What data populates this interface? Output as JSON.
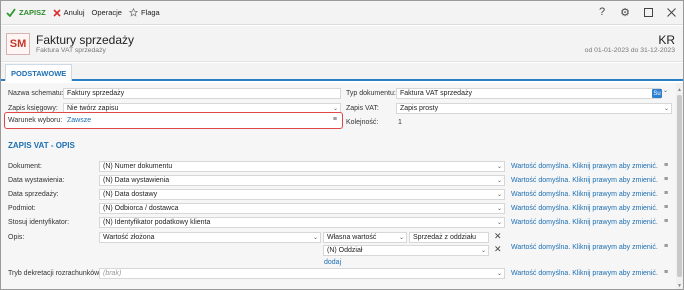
{
  "toolbar": {
    "save": "ZAPISZ",
    "cancel": "Anuluj",
    "operations": "Operacje",
    "flag": "Flaga"
  },
  "header": {
    "avatar": "SM",
    "title": "Faktury sprzedaży",
    "subtitle": "Faktura VAT sprzedaży",
    "code": "KR",
    "period": "od 01-01-2023 do 31-12-2023"
  },
  "tabs": [
    {
      "label": "PODSTAWOWE"
    }
  ],
  "basic": {
    "schema_name_label": "Nazwa schematu:",
    "schema_name_value": "Faktury sprzedaży",
    "booking_label": "Zapis księgowy:",
    "booking_value": "Nie twórz zapisu",
    "condition_label": "Warunek wyboru:",
    "condition_value": "Zawsze",
    "doc_type_label": "Typ dokumentu:",
    "doc_type_value": "Faktura VAT sprzedaży",
    "doc_type_badge": "Su",
    "vat_record_label": "Zapis VAT:",
    "vat_record_value": "Zapis prosty",
    "order_label": "Kolejność:",
    "order_value": "1"
  },
  "vat_section": {
    "title": "ZAPIS VAT - OPIS",
    "default_text": "Wartość domyślna. Kliknij prawym aby zmienić.",
    "rows": [
      {
        "label": "Dokument:",
        "value": "(N) Numer dokumentu"
      },
      {
        "label": "Data wystawienia:",
        "value": "(N) Data wystawienia"
      },
      {
        "label": "Data sprzedaży:",
        "value": "(N) Data dostawy"
      },
      {
        "label": "Podmiot:",
        "value": "(N) Odbiorca / dostawca"
      },
      {
        "label": "Stosuj identyfikator:",
        "value": "(N) Identyfikator podatkowy klienta"
      }
    ],
    "opis": {
      "label": "Opis:",
      "composite": "Wartość złożona",
      "own_value": "Własna wartość",
      "text": "Sprzedaż z oddziału",
      "branch": "(N) Oddział",
      "add": "dodaj"
    },
    "settlement": {
      "label": "Tryb dekretacji rozrachunków:",
      "placeholder": "(brak)"
    }
  }
}
